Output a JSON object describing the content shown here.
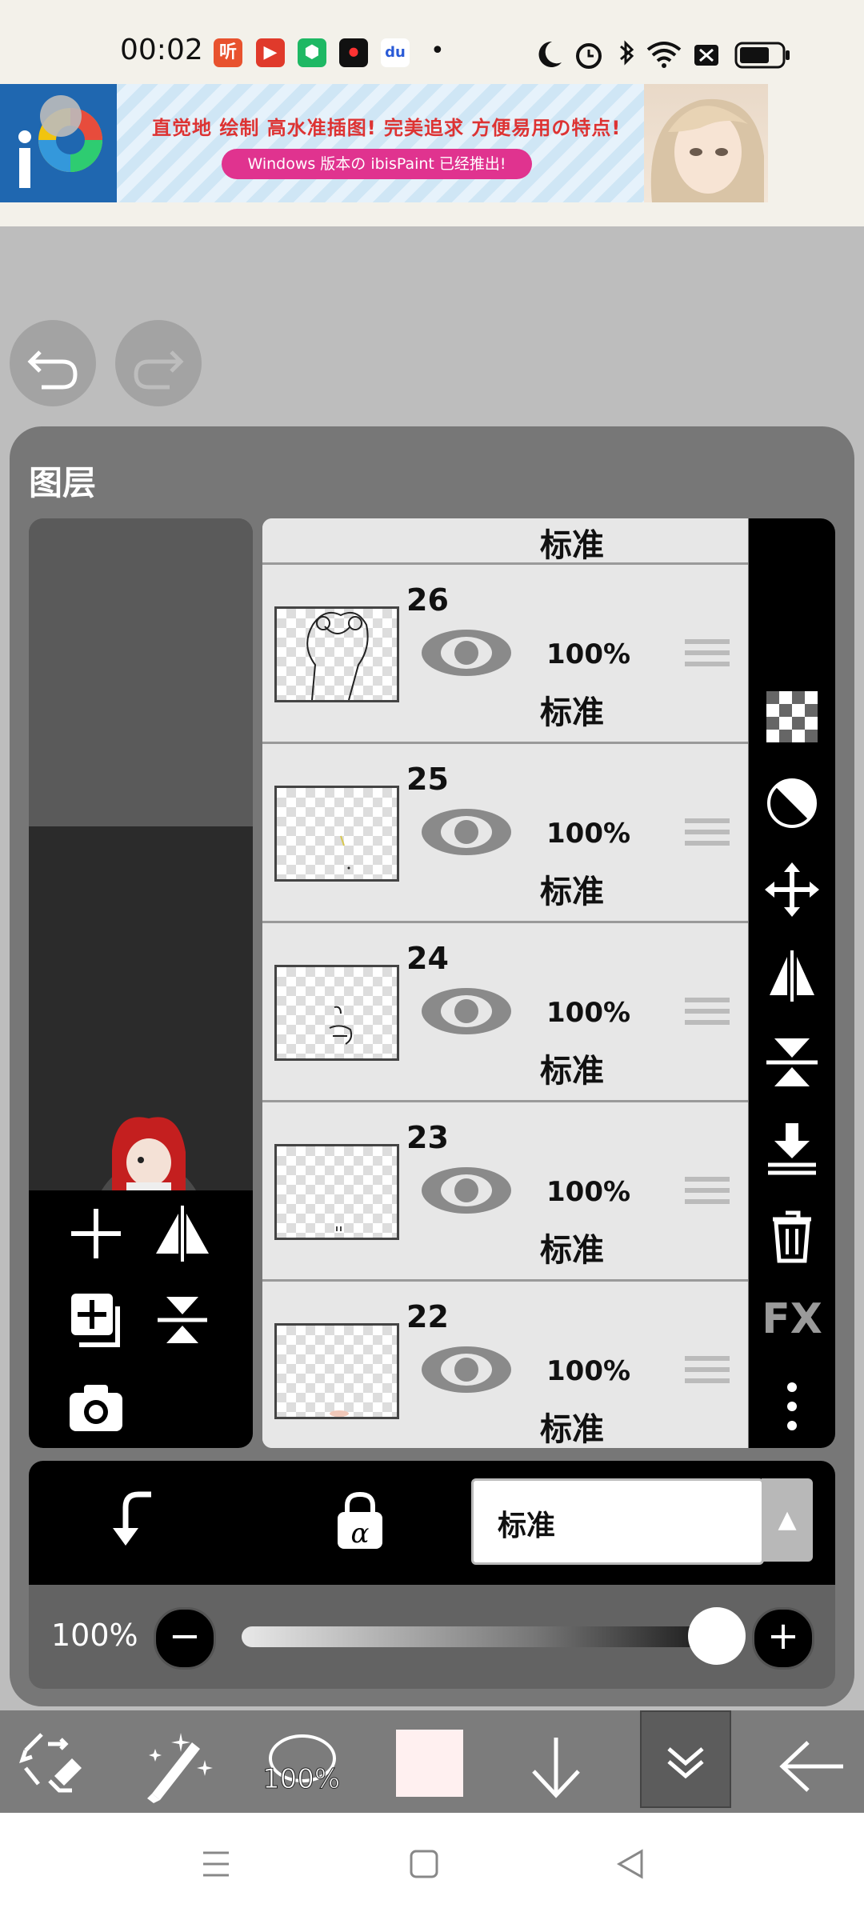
{
  "status_bar": {
    "time": "00:02",
    "app_icons": [
      "听",
      "▶",
      "⬢",
      "⏺",
      "du",
      "•"
    ],
    "right_icons": [
      "moon-icon",
      "alarm-icon",
      "bluetooth-icon",
      "wifi-icon",
      "x-box-icon",
      "battery-icon"
    ]
  },
  "ad": {
    "headline": "直觉地 绘制 高水准插图! 完美追求 方便易用の特点!",
    "sub": "Windows 版本の ibisPaint 已经推出!"
  },
  "canvas": {
    "undo_icon": "undo-icon",
    "redo_icon": "redo-icon"
  },
  "layers_panel": {
    "title": "图层",
    "partial_blend": "标准",
    "layers": [
      {
        "number": "26",
        "opacity": "100%",
        "blend": "标准"
      },
      {
        "number": "25",
        "opacity": "100%",
        "blend": "标准"
      },
      {
        "number": "24",
        "opacity": "100%",
        "blend": "标准"
      },
      {
        "number": "23",
        "opacity": "100%",
        "blend": "标准"
      },
      {
        "number": "22",
        "opacity": "100%",
        "blend": "标准"
      }
    ],
    "side_tools": [
      "checker-icon",
      "half-circle-icon",
      "move-icon",
      "flip-horizontal-icon",
      "flip-vertical-icon",
      "merge-down-icon",
      "trash-icon",
      "FX",
      "more-icon"
    ],
    "left_tools": [
      "add-layer-icon",
      "flip-layer-icon",
      "copy-layer-icon",
      "merge-icon",
      "camera-icon"
    ]
  },
  "blend_bar": {
    "selected_mode": "标准"
  },
  "opacity_bar": {
    "label": "100%",
    "value": 1.0
  },
  "toolbar": {
    "brush_size_label": "100%",
    "color": "#fff0f0"
  },
  "colors": {
    "panel_bg": "#777777",
    "list_bg": "#e7e7e7",
    "sidebar_bg": "#000000"
  }
}
